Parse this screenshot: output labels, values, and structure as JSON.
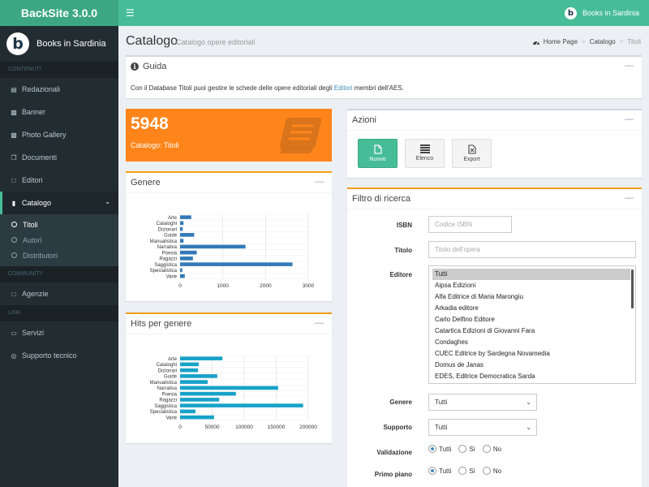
{
  "app": {
    "title": "BackSite 3.0.0",
    "user_label": "Books in Sardinia"
  },
  "sidebar": {
    "user_name": "Books in Sardinia",
    "sections": {
      "contenuti": "CONTENUTI",
      "community": "COMMUNITY",
      "link": "LINK"
    },
    "items": [
      {
        "label": "Redazionali",
        "icon": "file-text-icon"
      },
      {
        "label": "Banner",
        "icon": "image-icon"
      },
      {
        "label": "Photo Gallery",
        "icon": "photos-icon"
      },
      {
        "label": "Documenti",
        "icon": "copy-icon"
      },
      {
        "label": "Editori",
        "icon": "file-icon"
      },
      {
        "label": "Catalogo",
        "icon": "book-icon"
      }
    ],
    "catalogo_sub": [
      {
        "label": "Titoli"
      },
      {
        "label": "Autori"
      },
      {
        "label": "Distributori"
      }
    ],
    "community_items": [
      {
        "label": "Agenzie",
        "icon": "bank-icon"
      }
    ],
    "link_items": [
      {
        "label": "Servizi",
        "icon": "laptop-icon"
      },
      {
        "label": "Supporto tecnico",
        "icon": "lifebuoy-icon"
      }
    ]
  },
  "header": {
    "title": "Catalogo",
    "subtitle": "Catalogo opere editoriali",
    "breadcrumb": [
      "Home Page",
      "Catalogo",
      "Titoli"
    ]
  },
  "guida": {
    "title": "Guida",
    "text_before": "Con il Database Titoli puoi gestire le schede delle opere editoriali degli ",
    "link": "Editori",
    "text_after": " membri dell'AES."
  },
  "stat": {
    "value": "5948",
    "label": "Catalogo: Titoli"
  },
  "genere_box": {
    "title": "Genere"
  },
  "hits_box": {
    "title": "Hits per genere"
  },
  "azioni": {
    "title": "Azioni",
    "buttons": [
      {
        "label": "Nuovo"
      },
      {
        "label": "Elenco"
      },
      {
        "label": "Export"
      }
    ]
  },
  "filtro": {
    "title": "Filtro di ricerca",
    "isbn_label": "ISBN",
    "isbn_placeholder": "Codice ISBN",
    "titolo_label": "Titolo",
    "titolo_placeholder": "Titolo dell'opera",
    "editore_label": "Editore",
    "editori": [
      "Tutti",
      "Aipsa Edizioni",
      "Alfa Editrice di Maria Marongiu",
      "Arkadia editore",
      "Carlo Delfino Editore",
      "Catartica Edizioni di Giovanni Fara",
      "Condaghes",
      "CUEC Editrice by Sardegna Novamedia",
      "Domus de Janas",
      "EDES, Editrice Democratica Sarda"
    ],
    "genere_label": "Genere",
    "genere_value": "Tutti",
    "supporto_label": "Supporto",
    "supporto_value": "Tutti",
    "validazione_label": "Validazione",
    "primo_piano_label": "Primo piano",
    "radio_options": [
      "Tutti",
      "Sì",
      "No"
    ]
  },
  "colors": {
    "accent": "#47bd97",
    "sidebar": "#222d32",
    "orange": "#ff851b",
    "bar_genere": "#337ab7",
    "bar_hits": "#17a2c8"
  },
  "chart_data": [
    {
      "type": "bar",
      "orientation": "horizontal",
      "categories": [
        "Arte",
        "Cataloghi",
        "Dizionari",
        "Guide",
        "Manualistica",
        "Narrativa",
        "Poesia",
        "Ragazzi",
        "Saggistica",
        "Specialistica",
        "Varie"
      ],
      "values": [
        260,
        80,
        60,
        330,
        80,
        1530,
        390,
        300,
        2630,
        50,
        110
      ],
      "xlim": [
        0,
        3000
      ],
      "xticks": [
        "0",
        "1000",
        "2000",
        "3000"
      ],
      "grid": true
    },
    {
      "type": "bar",
      "orientation": "horizontal",
      "categories": [
        "Arte",
        "Cataloghi",
        "Dizionari",
        "Guide",
        "Manualistica",
        "Narrativa",
        "Poesia",
        "Ragazzi",
        "Saggistica",
        "Specialistica",
        "Varie"
      ],
      "values": [
        66000,
        29000,
        28000,
        58000,
        43000,
        153000,
        87000,
        61000,
        192000,
        24000,
        53000
      ],
      "xlim": [
        0,
        200000
      ],
      "xticks": [
        "0",
        "50000",
        "100000",
        "150000",
        "200000"
      ],
      "grid": true
    }
  ]
}
